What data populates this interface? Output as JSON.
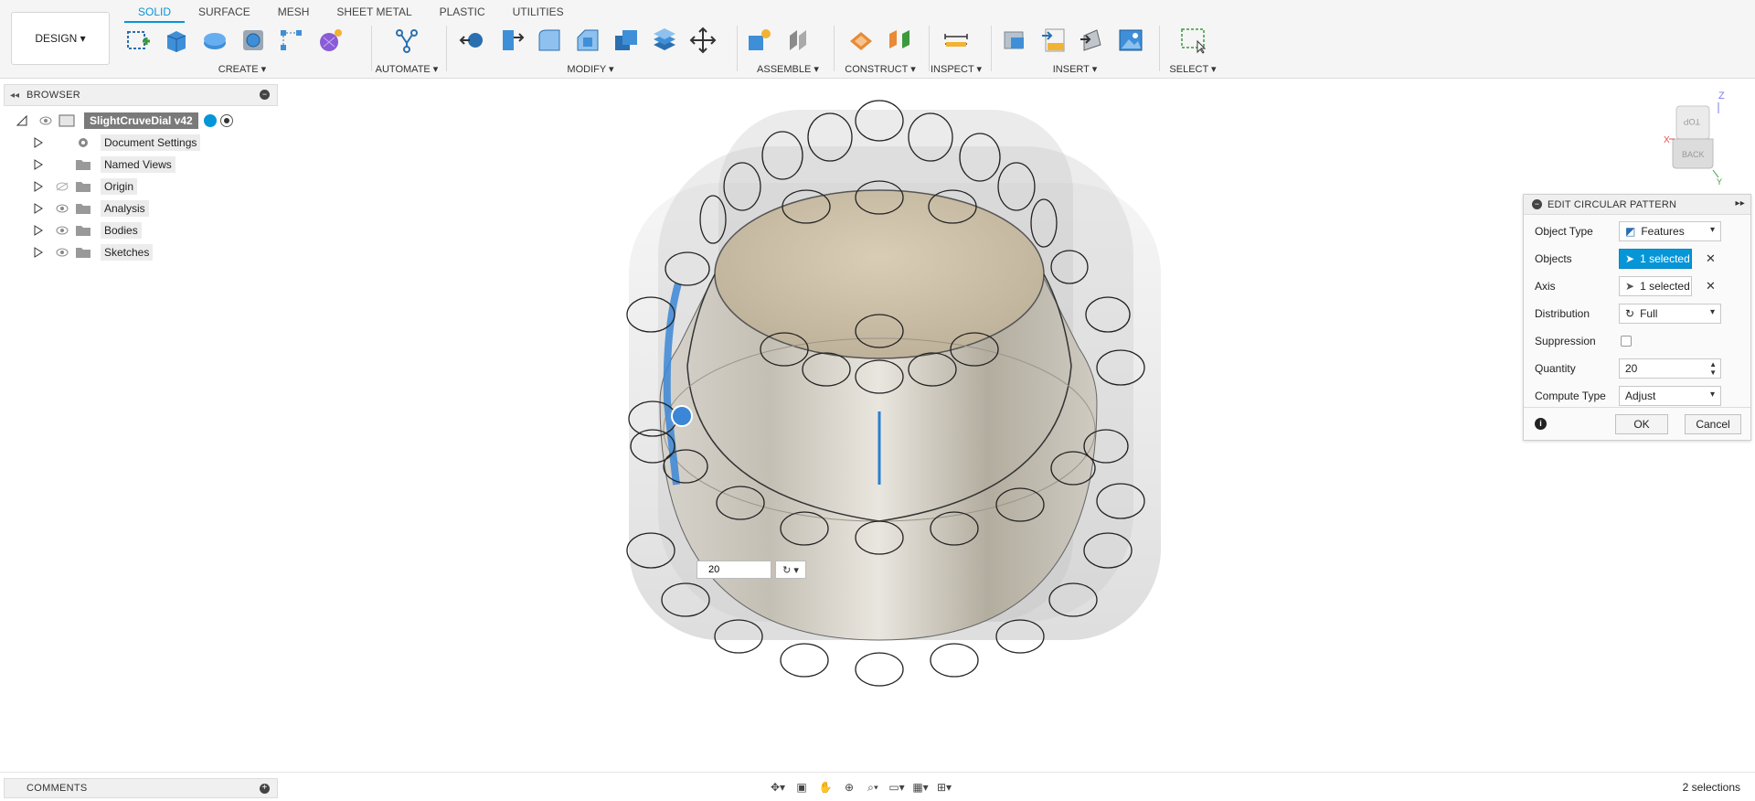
{
  "toolbar": {
    "workspace_label": "DESIGN ▾",
    "tabs": [
      "SOLID",
      "SURFACE",
      "MESH",
      "SHEET METAL",
      "PLASTIC",
      "UTILITIES"
    ],
    "groups": {
      "create": "CREATE ▾",
      "automate": "AUTOMATE ▾",
      "modify": "MODIFY ▾",
      "assemble": "ASSEMBLE ▾",
      "construct": "CONSTRUCT ▾",
      "inspect": "INSPECT ▾",
      "insert": "INSERT ▾",
      "select": "SELECT ▾"
    }
  },
  "browser": {
    "title": "BROWSER",
    "root": "SlightCruveDial v42",
    "items": [
      {
        "label": "Document Settings",
        "icon": "gear-icon"
      },
      {
        "label": "Named Views",
        "icon": "folder-icon"
      },
      {
        "label": "Origin",
        "icon": "folder-icon"
      },
      {
        "label": "Analysis",
        "icon": "folder-icon"
      },
      {
        "label": "Bodies",
        "icon": "folder-icon"
      },
      {
        "label": "Sketches",
        "icon": "folder-icon"
      }
    ]
  },
  "edit_panel": {
    "title": "EDIT CIRCULAR PATTERN",
    "rows": {
      "object_type": {
        "label": "Object Type",
        "value": "Features"
      },
      "objects": {
        "label": "Objects",
        "value": "1 selected"
      },
      "axis": {
        "label": "Axis",
        "value": "1 selected"
      },
      "distribution": {
        "label": "Distribution",
        "value": "Full"
      },
      "suppression": {
        "label": "Suppression"
      },
      "quantity": {
        "label": "Quantity",
        "value": "20"
      },
      "compute_type": {
        "label": "Compute Type",
        "value": "Adjust"
      }
    },
    "ok_label": "OK",
    "cancel_label": "Cancel"
  },
  "manipulator": {
    "quantity": "20"
  },
  "navcube": {
    "top": "TOP",
    "back": "BACK",
    "z": "Z",
    "x": "X",
    "y": "Y"
  },
  "comments": {
    "label": "COMMENTS"
  },
  "status": {
    "selections": "2 selections"
  },
  "colors": {
    "accent": "#0696d7",
    "model": "#b8b0a0"
  }
}
